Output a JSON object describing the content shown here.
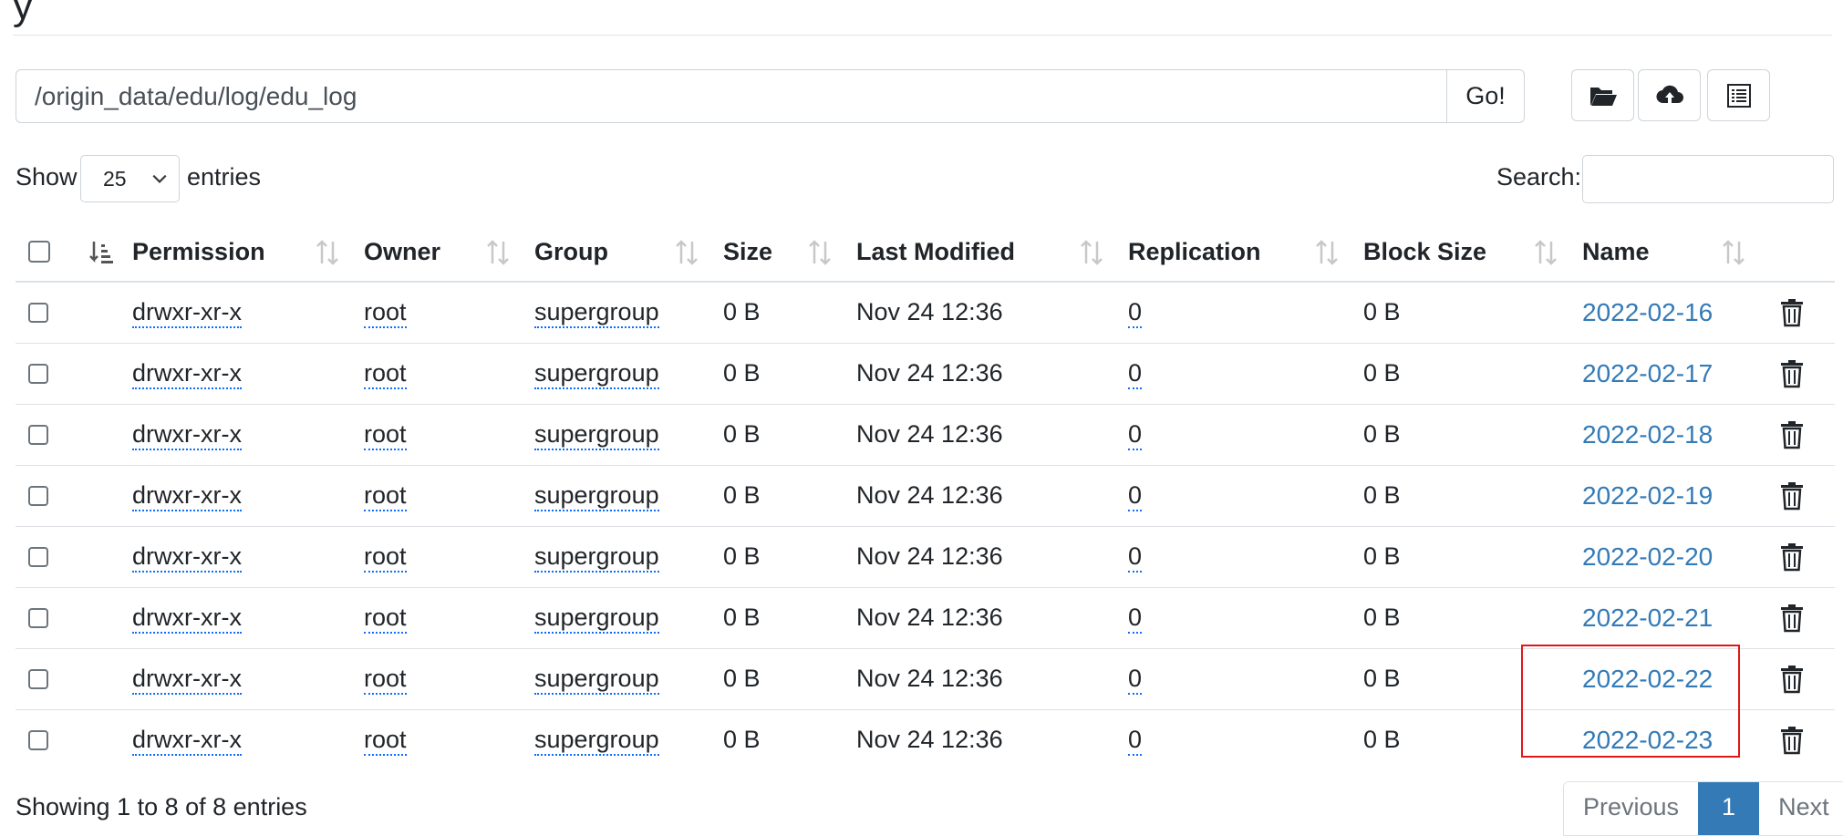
{
  "header": {
    "title_fragment": "y"
  },
  "path_bar": {
    "value": "/origin_data/edu/log/edu_log",
    "go_label": "Go!"
  },
  "toolbar": {
    "icons": [
      "folder-open-icon",
      "cloud-upload-icon",
      "list-icon"
    ]
  },
  "length": {
    "show_label": "Show",
    "selected": "25",
    "entries_label": "entries"
  },
  "search": {
    "label": "Search:",
    "value": ""
  },
  "table": {
    "headers": {
      "permission": "Permission",
      "owner": "Owner",
      "group": "Group",
      "size": "Size",
      "last_modified": "Last Modified",
      "replication": "Replication",
      "block_size": "Block Size",
      "name": "Name"
    },
    "rows": [
      {
        "permission": "drwxr-xr-x",
        "owner": "root",
        "group": "supergroup",
        "size": "0 B",
        "last_modified": "Nov 24 12:36",
        "replication": "0",
        "block_size": "0 B",
        "name": "2022-02-16"
      },
      {
        "permission": "drwxr-xr-x",
        "owner": "root",
        "group": "supergroup",
        "size": "0 B",
        "last_modified": "Nov 24 12:36",
        "replication": "0",
        "block_size": "0 B",
        "name": "2022-02-17"
      },
      {
        "permission": "drwxr-xr-x",
        "owner": "root",
        "group": "supergroup",
        "size": "0 B",
        "last_modified": "Nov 24 12:36",
        "replication": "0",
        "block_size": "0 B",
        "name": "2022-02-18"
      },
      {
        "permission": "drwxr-xr-x",
        "owner": "root",
        "group": "supergroup",
        "size": "0 B",
        "last_modified": "Nov 24 12:36",
        "replication": "0",
        "block_size": "0 B",
        "name": "2022-02-19"
      },
      {
        "permission": "drwxr-xr-x",
        "owner": "root",
        "group": "supergroup",
        "size": "0 B",
        "last_modified": "Nov 24 12:36",
        "replication": "0",
        "block_size": "0 B",
        "name": "2022-02-20"
      },
      {
        "permission": "drwxr-xr-x",
        "owner": "root",
        "group": "supergroup",
        "size": "0 B",
        "last_modified": "Nov 24 12:36",
        "replication": "0",
        "block_size": "0 B",
        "name": "2022-02-21"
      },
      {
        "permission": "drwxr-xr-x",
        "owner": "root",
        "group": "supergroup",
        "size": "0 B",
        "last_modified": "Nov 24 12:36",
        "replication": "0",
        "block_size": "0 B",
        "name": "2022-02-22"
      },
      {
        "permission": "drwxr-xr-x",
        "owner": "root",
        "group": "supergroup",
        "size": "0 B",
        "last_modified": "Nov 24 12:36",
        "replication": "0",
        "block_size": "0 B",
        "name": "2022-02-23"
      }
    ]
  },
  "footer": {
    "info": "Showing 1 to 8 of 8 entries",
    "pagination": {
      "previous": "Previous",
      "current": "1",
      "next": "Next"
    }
  },
  "colors": {
    "link": "#337ab7",
    "active_page": "#337ab7",
    "highlight": "#e01818"
  }
}
